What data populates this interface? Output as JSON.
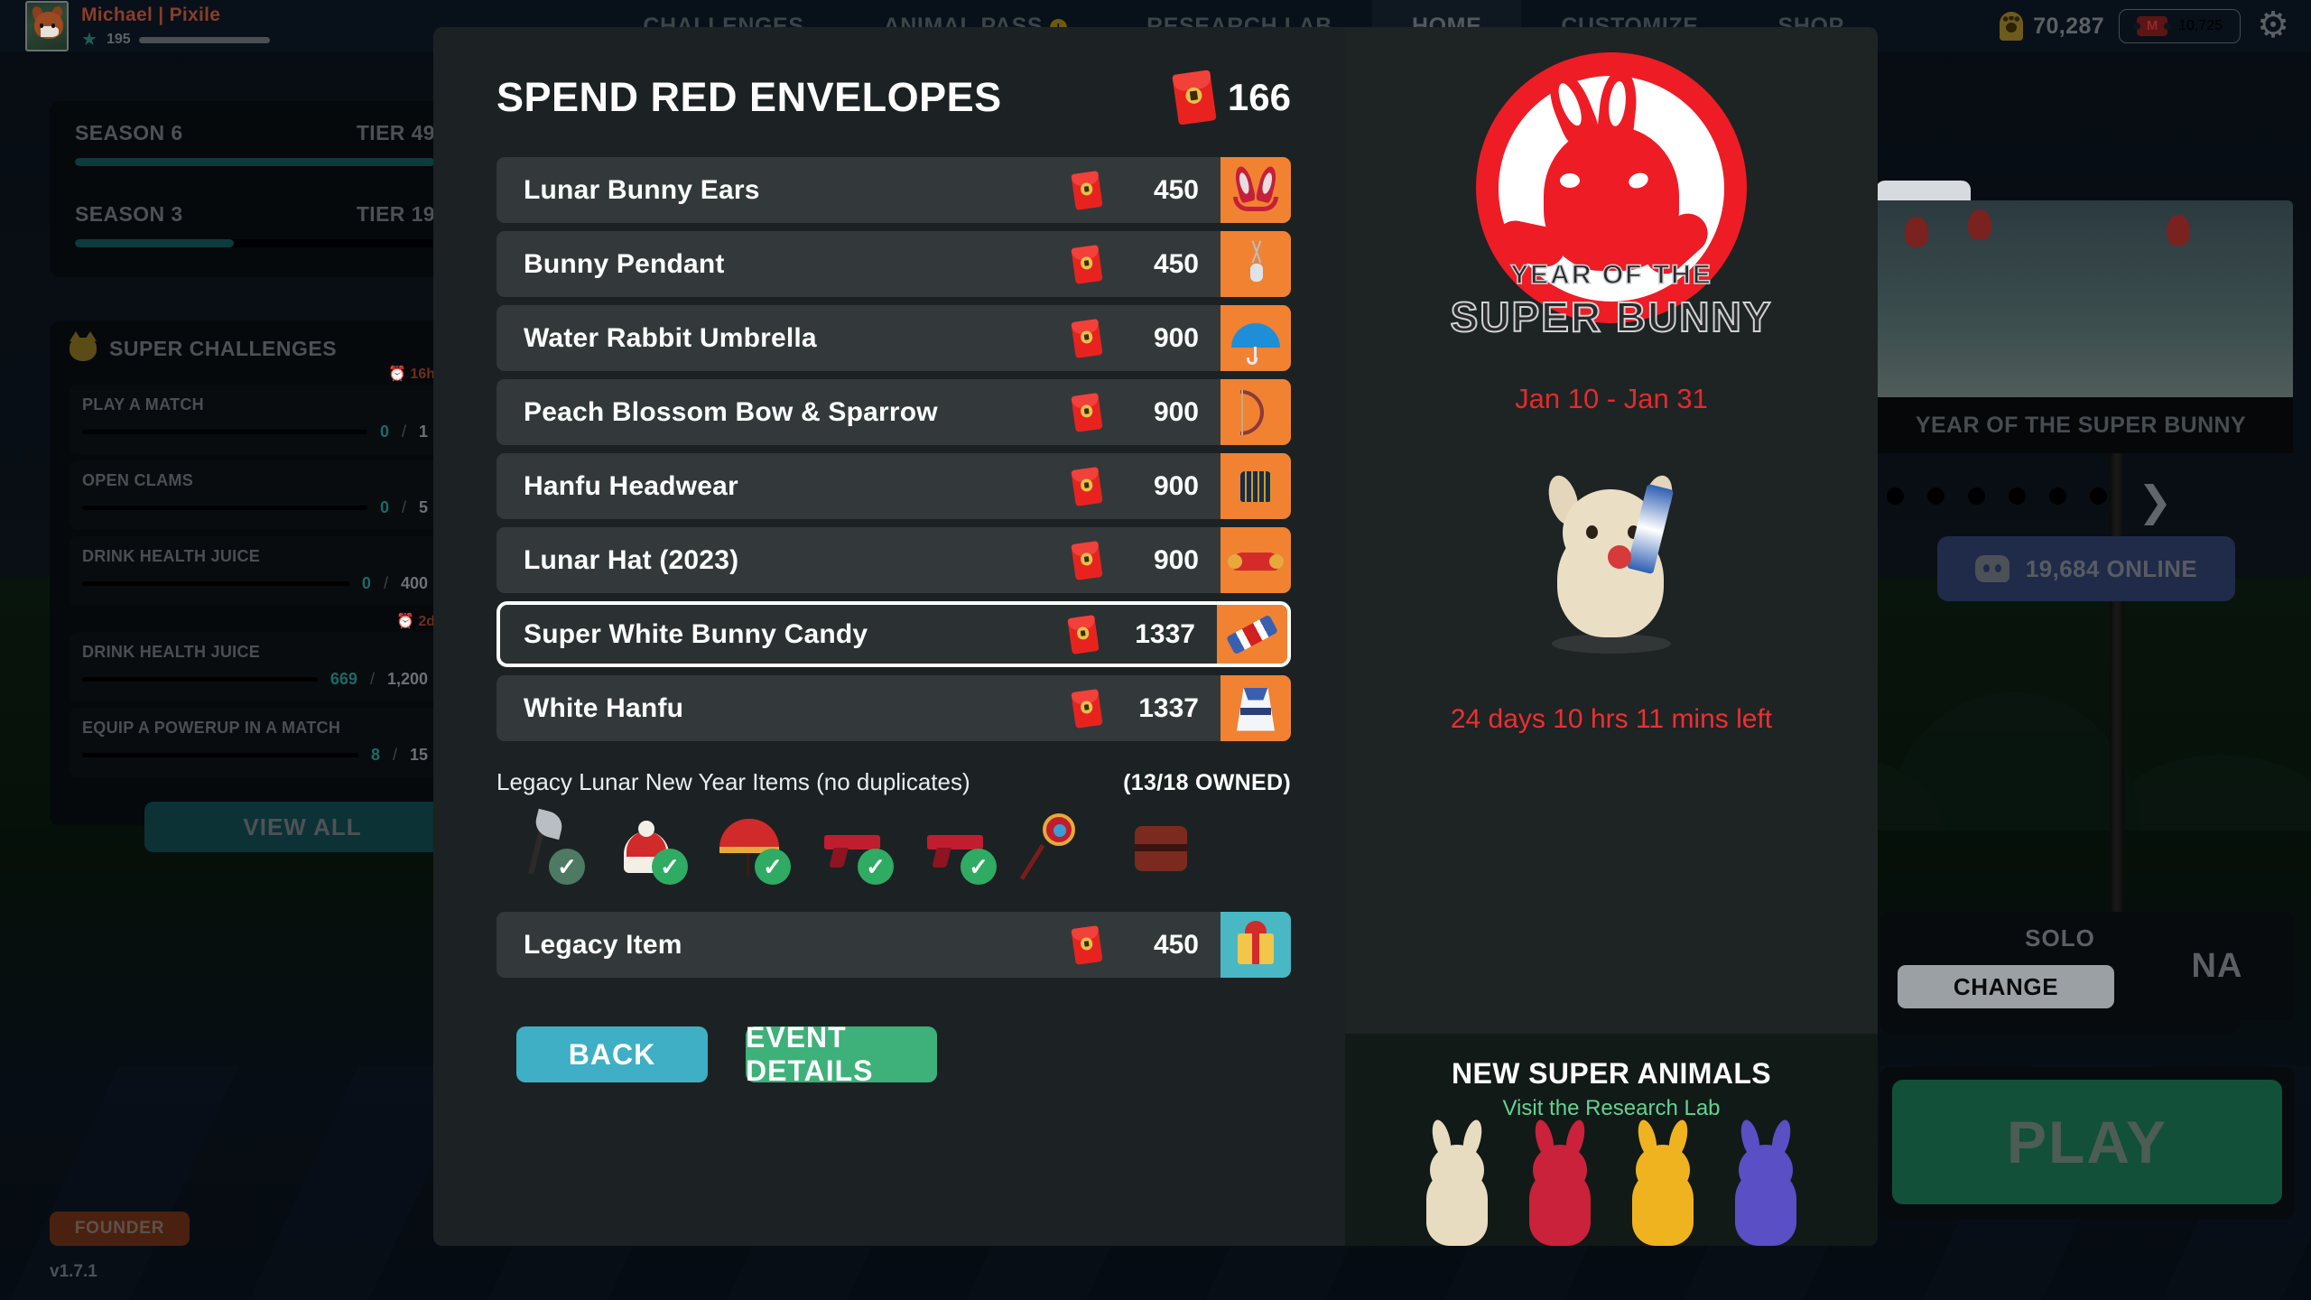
{
  "topbar": {
    "profile": {
      "name": "Michael | Pixile",
      "level": "195",
      "xp_percent": 22
    },
    "tabs": [
      {
        "label": "CHALLENGES",
        "active": false,
        "badge": ""
      },
      {
        "label": "ANIMAL PASS",
        "active": false,
        "badge": "!"
      },
      {
        "label": "RESEARCH LAB",
        "active": false,
        "badge": ""
      },
      {
        "label": "HOME",
        "active": true,
        "badge": ""
      },
      {
        "label": "CUSTOMIZE",
        "active": false,
        "badge": ""
      },
      {
        "label": "SHOP",
        "active": false,
        "badge": ""
      }
    ],
    "currency_paws": "70,287",
    "currency_tickets": "10,725",
    "gear_icon": "gear-icon"
  },
  "sidebar": {
    "seasons": [
      {
        "name": "SEASON 6",
        "tier": "TIER 49",
        "fill_percent": 100
      },
      {
        "name": "SEASON 3",
        "tier": "TIER 19",
        "fill_percent": 44
      }
    ],
    "challenges_title": "SUPER CHALLENGES",
    "timer_1": "16h",
    "timer_2": "2d",
    "challenges": [
      {
        "name": "PLAY A MATCH",
        "current": "0",
        "max": "1",
        "fill_percent": 0
      },
      {
        "name": "OPEN CLAMS",
        "current": "0",
        "max": "5",
        "fill_percent": 0
      },
      {
        "name": "DRINK HEALTH JUICE",
        "current": "0",
        "max": "400",
        "fill_percent": 0
      },
      {
        "name": "DRINK HEALTH JUICE",
        "current": "669",
        "max": "1,200",
        "fill_percent": 55
      },
      {
        "name": "EQUIP A POWERUP IN A MATCH",
        "current": "8",
        "max": "15",
        "fill_percent": 53
      }
    ],
    "view_all_label": "VIEW ALL",
    "founder_badge": "FOUNDER",
    "version": "v1.7.1"
  },
  "background": {
    "event_banner_label": "YEAR OF THE SUPER BUNNY",
    "carousel_dots": 6,
    "discord_online": "19,684 ONLINE",
    "mode_label": "SOLO",
    "change_label": "CHANGE",
    "region_label": "NA",
    "play_label": "PLAY"
  },
  "modal": {
    "title": "SPEND RED ENVELOPES",
    "balance": "166",
    "balance_icon": "red-envelope-icon",
    "items": [
      {
        "name": "Lunar Bunny Ears",
        "cost": "450",
        "art": "bunny-ears",
        "selected": false
      },
      {
        "name": "Bunny Pendant",
        "cost": "450",
        "art": "pendant",
        "selected": false
      },
      {
        "name": "Water Rabbit Umbrella",
        "cost": "900",
        "art": "umbrella",
        "selected": false
      },
      {
        "name": "Peach Blossom Bow & Sparrow",
        "cost": "900",
        "art": "bow",
        "selected": false
      },
      {
        "name": "Hanfu Headwear",
        "cost": "900",
        "art": "hanfu-hat",
        "selected": false
      },
      {
        "name": "Lunar Hat (2023)",
        "cost": "900",
        "art": "lunar-hat",
        "selected": false
      },
      {
        "name": "Super White Bunny Candy",
        "cost": "1337",
        "art": "candy",
        "selected": true
      },
      {
        "name": "White Hanfu",
        "cost": "1337",
        "art": "robe",
        "selected": false
      }
    ],
    "legacy": {
      "label": "Legacy Lunar New Year Items (no duplicates)",
      "owned": "(13/18 OWNED)",
      "thumbs": [
        {
          "art": "glaive",
          "owned": true,
          "dim": true
        },
        {
          "art": "beanie",
          "owned": true,
          "dim": false
        },
        {
          "art": "parasol",
          "owned": true,
          "dim": false
        },
        {
          "art": "pistol-a",
          "owned": true,
          "dim": false
        },
        {
          "art": "pistol-b",
          "owned": true,
          "dim": false
        },
        {
          "art": "fan",
          "owned": false,
          "dim": false
        },
        {
          "art": "drum",
          "owned": false,
          "dim": false
        }
      ],
      "row": {
        "name": "Legacy Item",
        "cost": "450",
        "art": "gift"
      }
    },
    "buttons": {
      "back": "BACK",
      "details": "EVENT DETAILS"
    },
    "right_panel": {
      "logo_line1": "YEAR OF THE",
      "logo_line2": "SUPER BUNNY",
      "dates": "Jan 10 - Jan 31",
      "time_left": "24 days 10 hrs 11 mins left",
      "nsa_title": "NEW SUPER ANIMALS",
      "nsa_sub": "Visit the Research Lab"
    }
  },
  "colors": {
    "accent_red": "#e52a2a",
    "envelope_red": "#e8231f",
    "thumb_orange": "#f08232",
    "back_button": "#3eafc4",
    "details_button": "#3eb079",
    "selected_border": "#ffffff",
    "modal_bg": "#1c2223",
    "row_bg": "#33393a",
    "check_green": "#2fab63"
  }
}
